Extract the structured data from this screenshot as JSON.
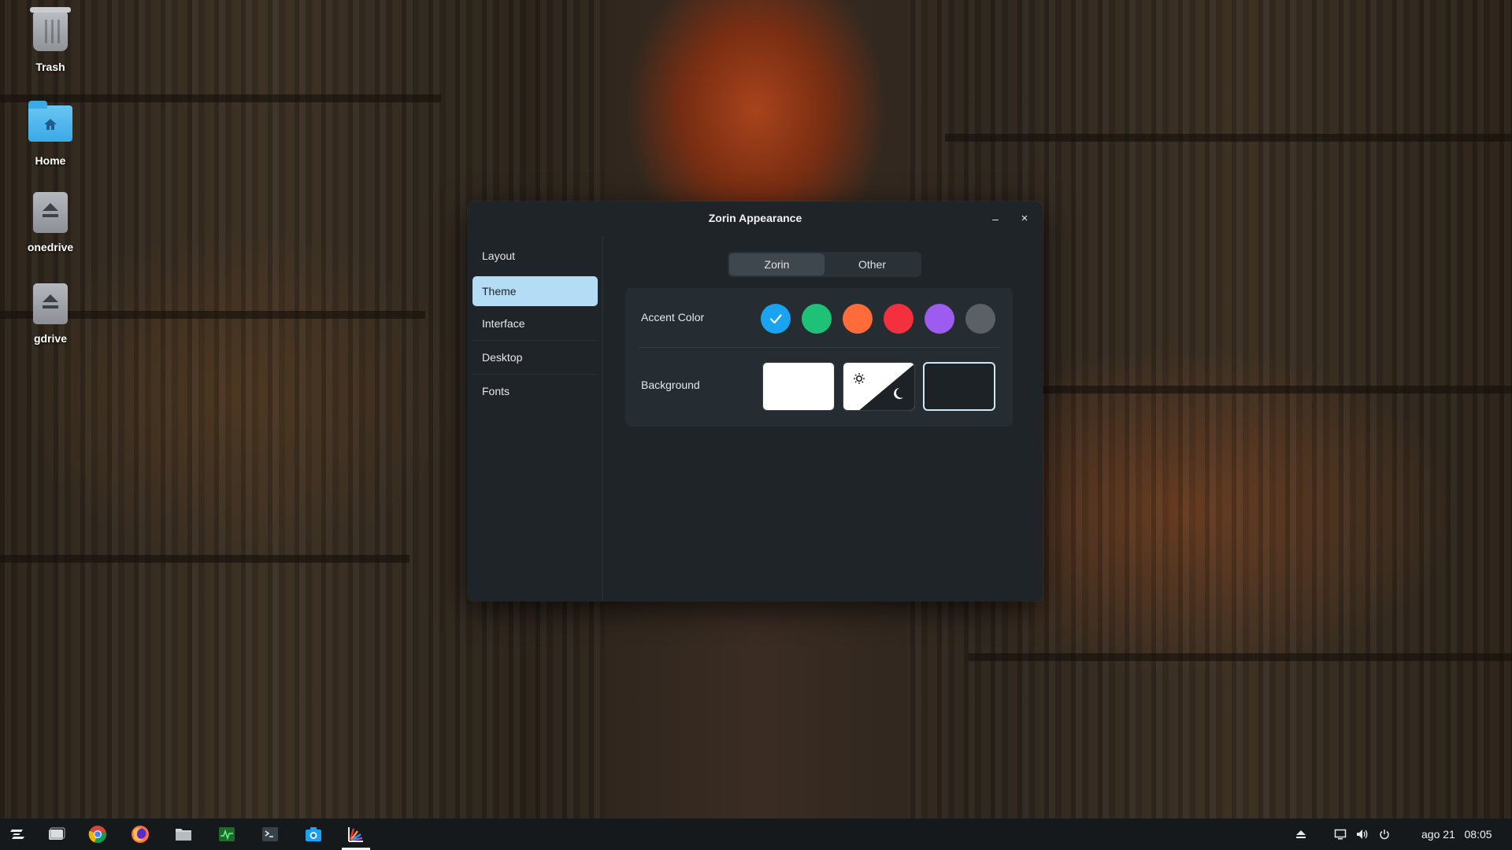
{
  "desktop": {
    "icons": [
      {
        "label": "Trash",
        "icon": "trash-icon"
      },
      {
        "label": "Home",
        "icon": "home-folder-icon"
      },
      {
        "label": "onedrive",
        "icon": "drive-icon"
      },
      {
        "label": "gdrive",
        "icon": "drive-icon"
      }
    ]
  },
  "window": {
    "title": "Zorin Appearance",
    "minimize_label": "–",
    "close_label": "×",
    "sidebar": {
      "items": [
        {
          "label": "Layout"
        },
        {
          "label": "Theme",
          "active": true
        },
        {
          "label": "Interface"
        },
        {
          "label": "Desktop"
        },
        {
          "label": "Fonts"
        }
      ]
    },
    "tabs": [
      {
        "label": "Zorin",
        "active": true
      },
      {
        "label": "Other"
      }
    ],
    "accent": {
      "label": "Accent Color",
      "colors": [
        "#1aa3f0",
        "#1ec277",
        "#ff6c3a",
        "#f4303f",
        "#9d5cf0",
        "#5a6066"
      ],
      "selected": 0
    },
    "background": {
      "label": "Background",
      "options": [
        "light",
        "auto",
        "dark"
      ],
      "selected": "dark"
    }
  },
  "taskbar": {
    "apps": [
      "zorin-menu-icon",
      "workspaces-icon",
      "chrome-icon",
      "firefox-icon",
      "files-icon",
      "system-monitor-icon",
      "terminal-icon",
      "screenshot-icon",
      "zorin-appearance-icon"
    ],
    "active_app": "zorin-appearance-icon",
    "date": "ago 21",
    "time": "08:05"
  }
}
